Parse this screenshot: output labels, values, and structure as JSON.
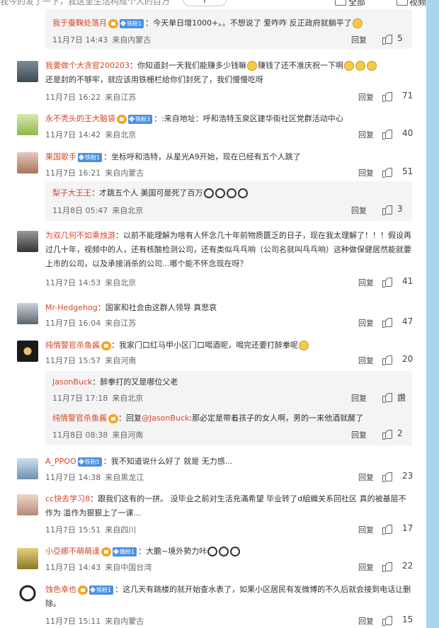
{
  "topbar": {
    "search_text": "我今的发了一下，我这里生活构成个人的百万",
    "plus": "+",
    "items": [
      "全部",
      "视频"
    ]
  },
  "labels": {
    "reply": "回复"
  },
  "comments": [
    {
      "username": "我于蚕麴处落月",
      "badge": "铁粉1",
      "text": "：今天单日增1000+。。不想说了 爱咋咋 反正政府就躺平了",
      "date": "11月7日 14:43",
      "location": "来自内蒙古",
      "likes": "5"
    },
    {
      "username": "我要做个大贪官200203",
      "text": "：你知道封一天我们能赚多少钱嘛",
      "text2": "赚钱了还不准庆祝一下啊",
      "text_cont": "还是封的不够牢，就应该用铁栅栏给你们封死了，我们慢慢吃呀",
      "date": "11月7日 16:22",
      "location": "来自江苏",
      "likes": "71"
    },
    {
      "username": "永不秃头的王大脑袋",
      "badge": "铁粉3",
      "text": "：:来自地址：呼和浩特玉泉区建华街社区党群活动中心",
      "date": "11月7日 14:42",
      "location": "来自北京",
      "likes": "40"
    },
    {
      "username": "果国歌手",
      "badge": "铁粉1",
      "text": "：坐标呼和浩特，从星光A9开始，现在已经有五个人跳了",
      "date": "11月7日 16:21",
      "location": "来自内蒙古",
      "likes": "51"
    },
    {
      "username": "梨子大王王",
      "text": "：才跳五个人 美国可是死了百万",
      "date": "11月8日 05:47",
      "location": "来自北京",
      "likes": "3"
    },
    {
      "username": "为双几何不如乘烛游",
      "text": "：以前不能理解为啥有人怀念几十年前物质匮乏的日子，现在我太理解了！！！假设再过几十年，视频中的人，还有核酸检测公司，还有类似乓乓响（公司名就叫乓乓响）这种做保健居然能就要上市的公司，以及承接消杀的公司...哪个能不怀念现在呀？",
      "date": "11月7日 14:53",
      "location": "来自北京",
      "likes": "41"
    },
    {
      "username": "Mr-Hedgehog",
      "text": "：国家和社会由这群人领导 真悲哀",
      "date": "11月7日 16:04",
      "location": "来自江苏",
      "likes": "47"
    },
    {
      "username": "纯情警官杀鱼酱",
      "text": "：我家门口红马甲小区门口喝酒呢，喝完还要打醉拳呢",
      "date": "11月7日 15:57",
      "location": "来自河南",
      "likes": "20"
    },
    {
      "username": "JasonBuck",
      "text": "：醉拳打的又是哪位父老",
      "date": "11月7日 17:18",
      "location": "来自北京",
      "likes": "讚"
    },
    {
      "username": "纯情警官杀鱼酱",
      "text_pre": "：回复",
      "mention": "@JasonBuck",
      "text": ":那必定是带着孩子的女人啊，男的一来他酒就醒了",
      "date": "11月8日 08:38",
      "location": "来自河南",
      "likes": "2"
    },
    {
      "username": "A_PPOO",
      "badge": "铁粉5",
      "text": "：我不知道说什么好了 就是 无力感...",
      "date": "11月7日 14:38",
      "location": "来自黑龙江",
      "likes": "23"
    },
    {
      "username": "cc快去学习8",
      "text": "：跟我们这有的一拼。 没毕业之前对生活充滿希望 毕业转了d組織关系回社区 真的被基层不作为 滥作为狠狠上了一课...",
      "date": "11月7日 15:51",
      "location": "来自四川",
      "likes": "17"
    },
    {
      "username": "小亞娜不萌萌達",
      "badge": "鐵粉1",
      "text": "：大膽~境外勢力咔",
      "date": "11月7日 14:43",
      "location": "来自中国台湾",
      "likes": "22"
    },
    {
      "username": "蚀色幸也",
      "badge": "铁粉1",
      "text": "：这几天有跳楼的就开始查水表了，如果小区居民有发微博的不久后就会接到电话让删除。",
      "date": "11月7日 15:11",
      "location": "来自内蒙古",
      "likes": "15"
    }
  ]
}
